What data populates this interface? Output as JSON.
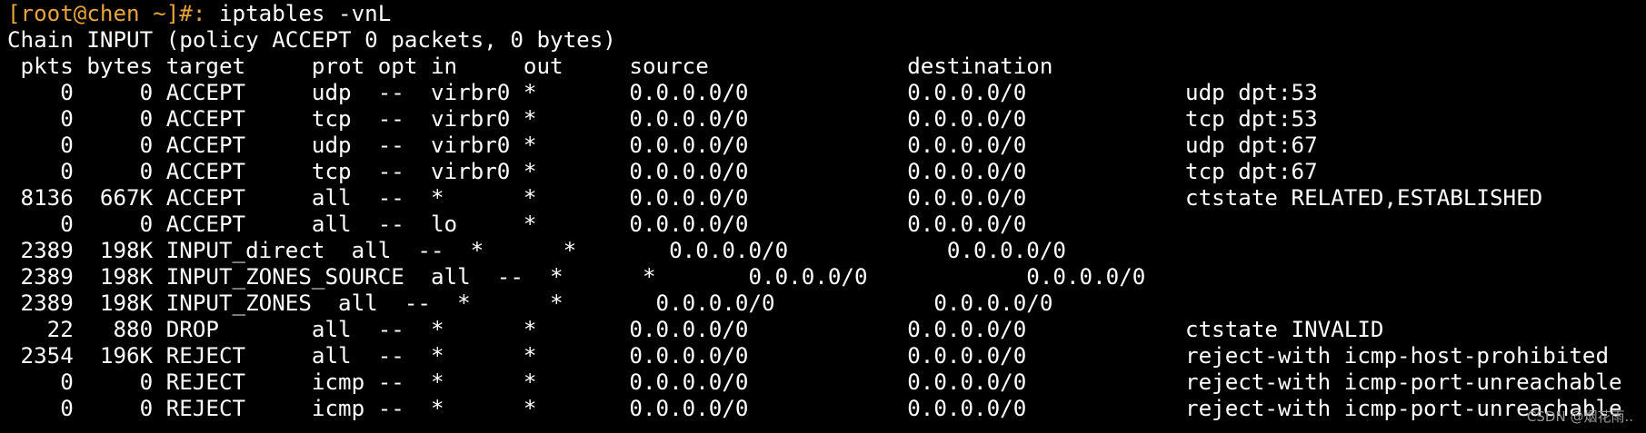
{
  "colors": {
    "background": "#000000",
    "foreground": "#ffffff",
    "prompt": "#e8a33d",
    "watermark": "#9a9a9a"
  },
  "prompt": "[root@chen ~]#:",
  "command": " iptables -vnL",
  "chain_header": "Chain INPUT (policy ACCEPT 0 packets, 0 bytes)",
  "column_header": " pkts bytes target     prot opt in     out     source               destination",
  "rows": [
    "    0     0 ACCEPT     udp  --  virbr0 *       0.0.0.0/0            0.0.0.0/0            udp dpt:53",
    "    0     0 ACCEPT     tcp  --  virbr0 *       0.0.0.0/0            0.0.0.0/0            tcp dpt:53",
    "    0     0 ACCEPT     udp  --  virbr0 *       0.0.0.0/0            0.0.0.0/0            udp dpt:67",
    "    0     0 ACCEPT     tcp  --  virbr0 *       0.0.0.0/0            0.0.0.0/0            tcp dpt:67",
    " 8136  667K ACCEPT     all  --  *      *       0.0.0.0/0            0.0.0.0/0            ctstate RELATED,ESTABLISHED",
    "    0     0 ACCEPT     all  --  lo     *       0.0.0.0/0            0.0.0.0/0",
    " 2389  198K INPUT_direct  all  --  *      *       0.0.0.0/0            0.0.0.0/0",
    " 2389  198K INPUT_ZONES_SOURCE  all  --  *      *       0.0.0.0/0            0.0.0.0/0",
    " 2389  198K INPUT_ZONES  all  --  *      *       0.0.0.0/0            0.0.0.0/0",
    "   22   880 DROP       all  --  *      *       0.0.0.0/0            0.0.0.0/0            ctstate INVALID",
    " 2354  196K REJECT     all  --  *      *       0.0.0.0/0            0.0.0.0/0            reject-with icmp-host-prohibited",
    "    0     0 REJECT     icmp --  *      *       0.0.0.0/0            0.0.0.0/0            reject-with icmp-port-unreachable",
    "    0     0 REJECT     icmp --  *      *       0.0.0.0/0            0.0.0.0/0            reject-with icmp-port-unreachable"
  ],
  "watermark": "CSDN @烟花雨.."
}
